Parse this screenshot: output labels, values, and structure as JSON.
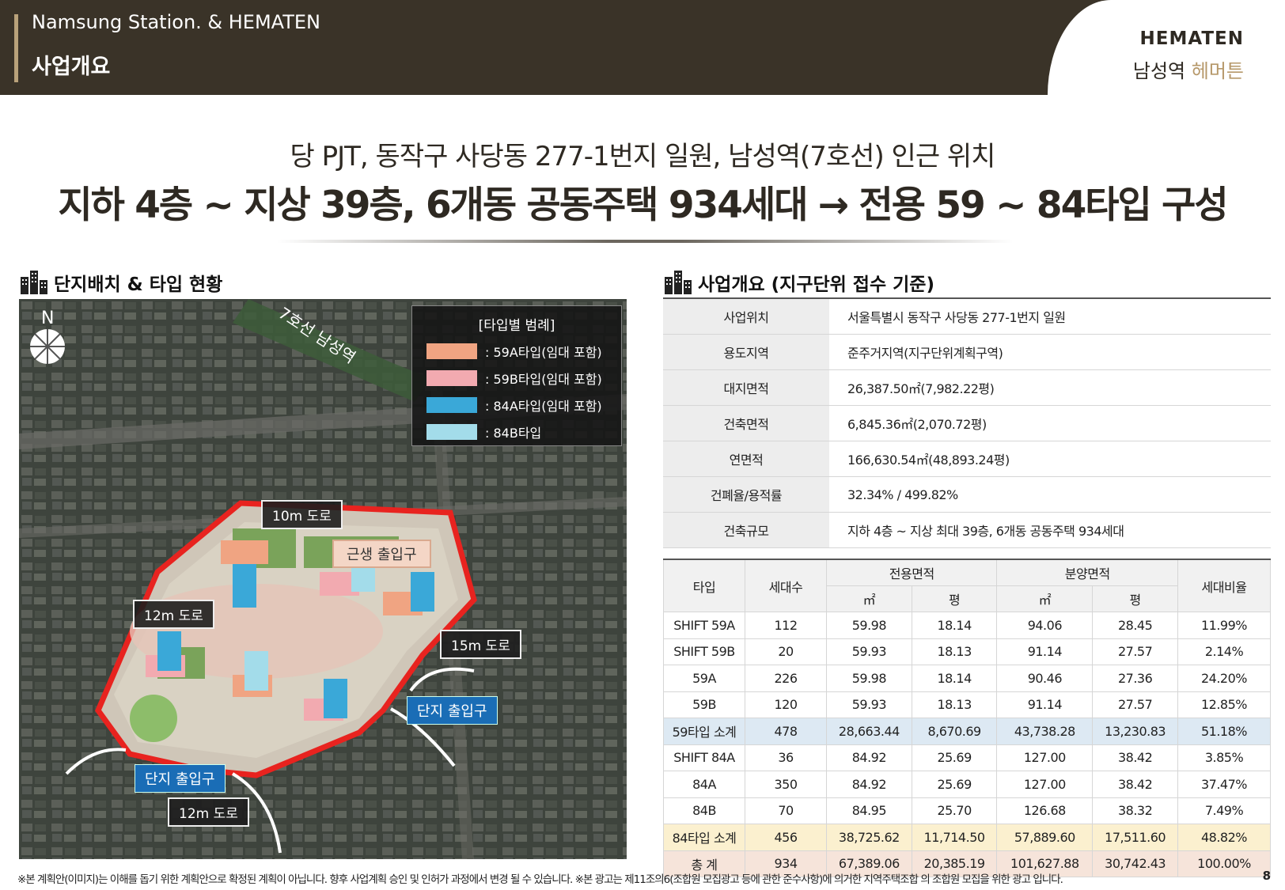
{
  "header": {
    "subtitle_en": "Namsung Station. & HEMATEN",
    "title_ko": "사업개요"
  },
  "brand": {
    "en": "HEMATEN",
    "ko_station": "남성역",
    "ko_name": "헤머튼"
  },
  "headline": {
    "line1": "당 PJT, 동작구 사당동 277-1번지 일원, 남성역(7호선) 인근 위치",
    "line2": "지하 4층 ~ 지상 39층, 6개동 공동주택 934세대 → 전용 59 ~ 84타입 구성"
  },
  "left_section": {
    "title": "단지배치 & 타입 현황",
    "north": "N",
    "station_label": "7호선 남성역",
    "legend": {
      "title": "[타입별 범례]",
      "items": [
        {
          "label": ": 59A타입(임대 포함)",
          "color": "#f0a482"
        },
        {
          "label": ": 59B타입(임대 포함)",
          "color": "#f2aab0"
        },
        {
          "label": ": 84A타입(임대 포함)",
          "color": "#3aa8d8"
        },
        {
          "label": ": 84B타입",
          "color": "#a3dcea"
        }
      ]
    },
    "roads": {
      "r10": "10m 도로",
      "r12a": "12m 도로",
      "r15": "15m 도로",
      "r12b": "12m 도로"
    },
    "retail_gate": "근생 출입구",
    "gates": {
      "g1": "단지 출입구",
      "g2": "단지 출입구"
    }
  },
  "right_section": {
    "title": "사업개요 (지구단위 접수 기준)",
    "overview": [
      {
        "k": "사업위치",
        "v": "서울특별시 동작구 사당동 277-1번지 일원"
      },
      {
        "k": "용도지역",
        "v": "준주거지역(지구단위계획구역)"
      },
      {
        "k": "대지면적",
        "v": "26,387.50㎡(7,982.22평)"
      },
      {
        "k": "건축면적",
        "v": "6,845.36㎡(2,070.72평)"
      },
      {
        "k": "연면적",
        "v": "166,630.54㎡(48,893.24평)"
      },
      {
        "k": "건폐율/용적률",
        "v": "32.34% / 499.82%"
      },
      {
        "k": "건축규모",
        "v": "지하 4층 ~ 지상 최대 39층, 6개동 공동주택 934세대"
      }
    ],
    "type_table": {
      "headers": {
        "type": "타입",
        "units": "세대수",
        "exclusive": "전용면적",
        "sale": "분양면적",
        "m2": "㎡",
        "pyeong": "평",
        "ratio": "세대비율"
      },
      "rows": [
        [
          "SHIFT 59A",
          "112",
          "59.98",
          "18.14",
          "94.06",
          "28.45",
          "11.99%"
        ],
        [
          "SHIFT 59B",
          "20",
          "59.93",
          "18.13",
          "91.14",
          "27.57",
          "2.14%"
        ],
        [
          "59A",
          "226",
          "59.98",
          "18.14",
          "90.46",
          "27.36",
          "24.20%"
        ],
        [
          "59B",
          "120",
          "59.93",
          "18.13",
          "91.14",
          "27.57",
          "12.85%"
        ],
        [
          "59타입 소계",
          "478",
          "28,663.44",
          "8,670.69",
          "43,738.28",
          "13,230.83",
          "51.18%"
        ],
        [
          "SHIFT 84A",
          "36",
          "84.92",
          "25.69",
          "127.00",
          "38.42",
          "3.85%"
        ],
        [
          "84A",
          "350",
          "84.92",
          "25.69",
          "127.00",
          "38.42",
          "37.47%"
        ],
        [
          "84B",
          "70",
          "84.95",
          "25.70",
          "126.68",
          "38.32",
          "7.49%"
        ],
        [
          "84타입 소계",
          "456",
          "38,725.62",
          "11,714.50",
          "57,889.60",
          "17,511.60",
          "48.82%"
        ],
        [
          "총 계",
          "934",
          "67,389.06",
          "20,385.19",
          "101,627.88",
          "30,742.43",
          "100.00%"
        ]
      ]
    }
  },
  "footnote": "※본 계획안(이미지)는 이해를 돕기 위한 계획안으로 확정된 계획이 아닙니다. 향후 사업계획 승인 및 인허가 과정에서 변경 될 수 있습니다. ※본 광고는 제11조의6(조합원 모집광고 등에 관한 준수사항)에 의거한 지역주택조합 의 조합원 모집을 위한 광고 입니다.",
  "page_number": "8"
}
